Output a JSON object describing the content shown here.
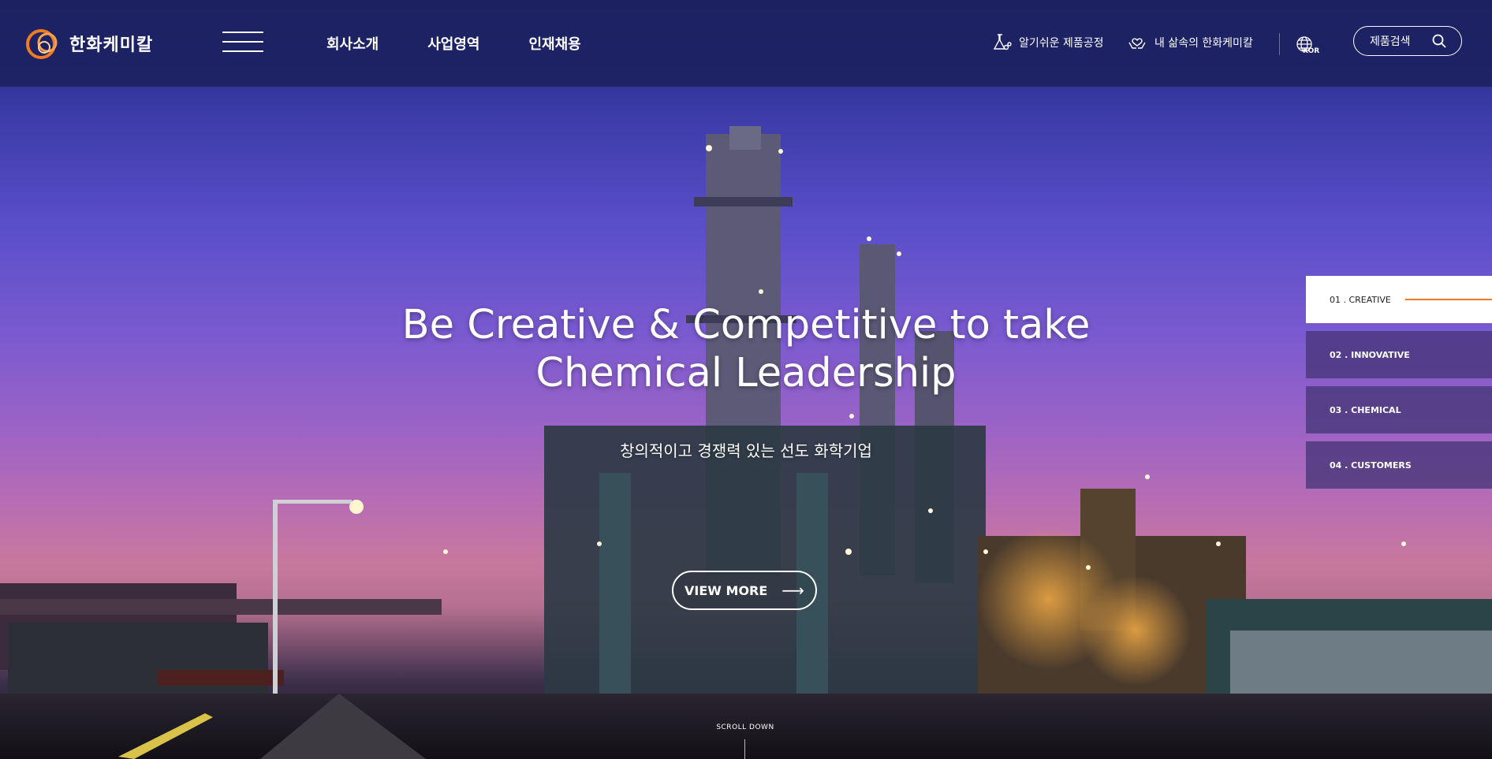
{
  "header": {
    "logo_text": "한화케미칼",
    "nav": [
      "회사소개",
      "사업영역",
      "인재채용"
    ],
    "util_process": "알기쉬운 제품공정",
    "util_life": "내 삶속의 한화케미칼",
    "lang": "KOR",
    "search_label": "제품검색"
  },
  "hero": {
    "headline_line1": "Be Creative & Competitive to take",
    "headline_line2": "Chemical Leadership",
    "subline": "창의적이고 경쟁력 있는 선도 화학기업",
    "view_more": "VIEW MORE",
    "scroll_down": "SCROLL DOWN"
  },
  "tabs": [
    {
      "label": "01 . CREATIVE",
      "active": true
    },
    {
      "label": "02 . INNOVATIVE",
      "active": false
    },
    {
      "label": "03 . CHEMICAL",
      "active": false
    },
    {
      "label": "04 . CUSTOMERS",
      "active": false
    }
  ],
  "colors": {
    "header_bg": "#1c2262",
    "accent": "#ef7b22",
    "tab_bg": "#46367a"
  },
  "icons": [
    "logo-mark",
    "hamburger-icon",
    "flask-icon",
    "hands-heart-icon",
    "globe-icon",
    "search-icon",
    "arrow-right-icon"
  ]
}
